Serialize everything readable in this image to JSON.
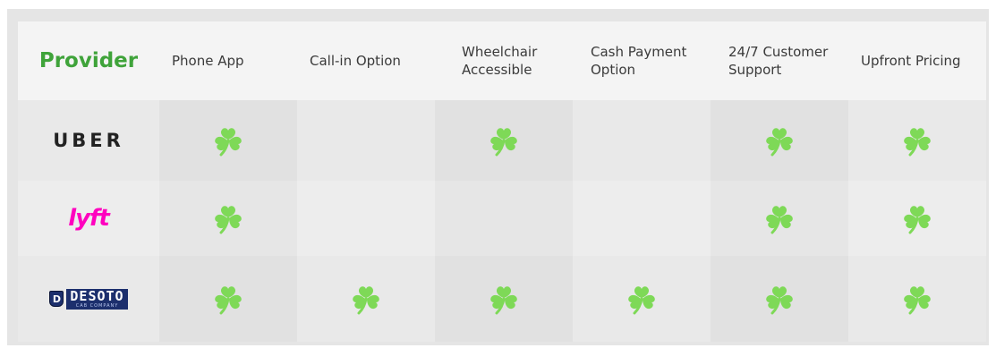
{
  "header": {
    "provider_label": "Provider",
    "columns": [
      "Phone App",
      "Call-in Option",
      "Wheelchair Accessible",
      "Cash Payment Option",
      "24/7 Customer Support",
      "Upfront Pricing"
    ]
  },
  "providers": [
    {
      "name": "UBER",
      "logo_type": "wordmark",
      "features": [
        true,
        false,
        true,
        false,
        true,
        true
      ]
    },
    {
      "name": "lyft",
      "logo_type": "pink-wordmark",
      "features": [
        true,
        false,
        false,
        false,
        true,
        true
      ]
    },
    {
      "name": "DESOTO",
      "tagline": "CAB COMPANY",
      "logo_type": "shield-wordmark",
      "features": [
        true,
        true,
        true,
        true,
        true,
        true
      ]
    }
  ],
  "icons": {
    "check_mark": "shamrock-icon"
  },
  "colors": {
    "provider_header": "#3fa33a",
    "shamrock": "#7ed957",
    "lyft_pink": "#ff00bf",
    "desoto_navy": "#1c2f6d",
    "frame_bg": "#e5e5e5"
  }
}
